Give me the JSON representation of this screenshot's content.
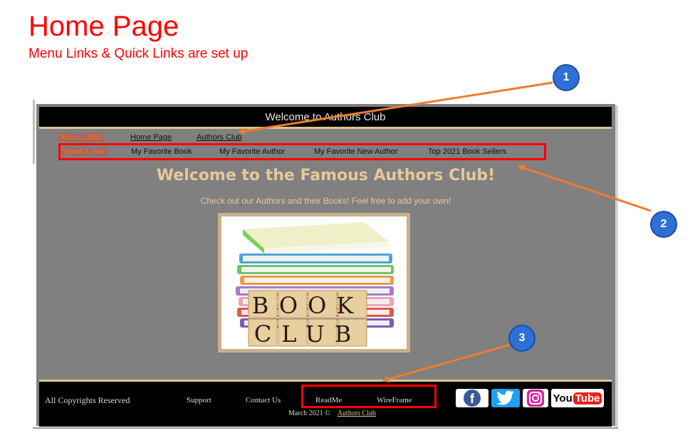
{
  "slide": {
    "title": "Home Page",
    "subtitle": "Menu Links & Quick Links are set up"
  },
  "site": {
    "header_title": "Welcome to Authors Club",
    "menu_label": "\"Menu Links\"",
    "menu_links": [
      "Home Page",
      "Authors Club"
    ],
    "quick_label": "\"Quick Links\"",
    "quick_links": [
      "My Favorite Book",
      "My Favorite Author",
      "My Favorite New Author",
      "Top 2021 Book Sellers"
    ],
    "hero_title": "Welcome to the Famous Authors Club!",
    "hero_subtitle": "Check out our Authors and their Books! Feel free to add your own!",
    "book_image_text": [
      "BOOK",
      "CLUB"
    ],
    "footer": {
      "copyright": "All Copyrights Reserved",
      "links": [
        "Support",
        "Contact Us",
        "ReadMe",
        "WireFrame"
      ],
      "date": "March 2021 ©",
      "authors_club_link": "Authors Club",
      "social": {
        "facebook": "f",
        "youtube_you": "You",
        "youtube_tube": "Tube"
      }
    }
  },
  "callouts": [
    "1",
    "2",
    "3"
  ],
  "colors": {
    "annotation_red": "#ff0000",
    "arrow_orange": "#ed7d31",
    "callout_blue": "#2e6fd8",
    "site_bg": "#808080",
    "hero_text": "#e8c79a"
  }
}
